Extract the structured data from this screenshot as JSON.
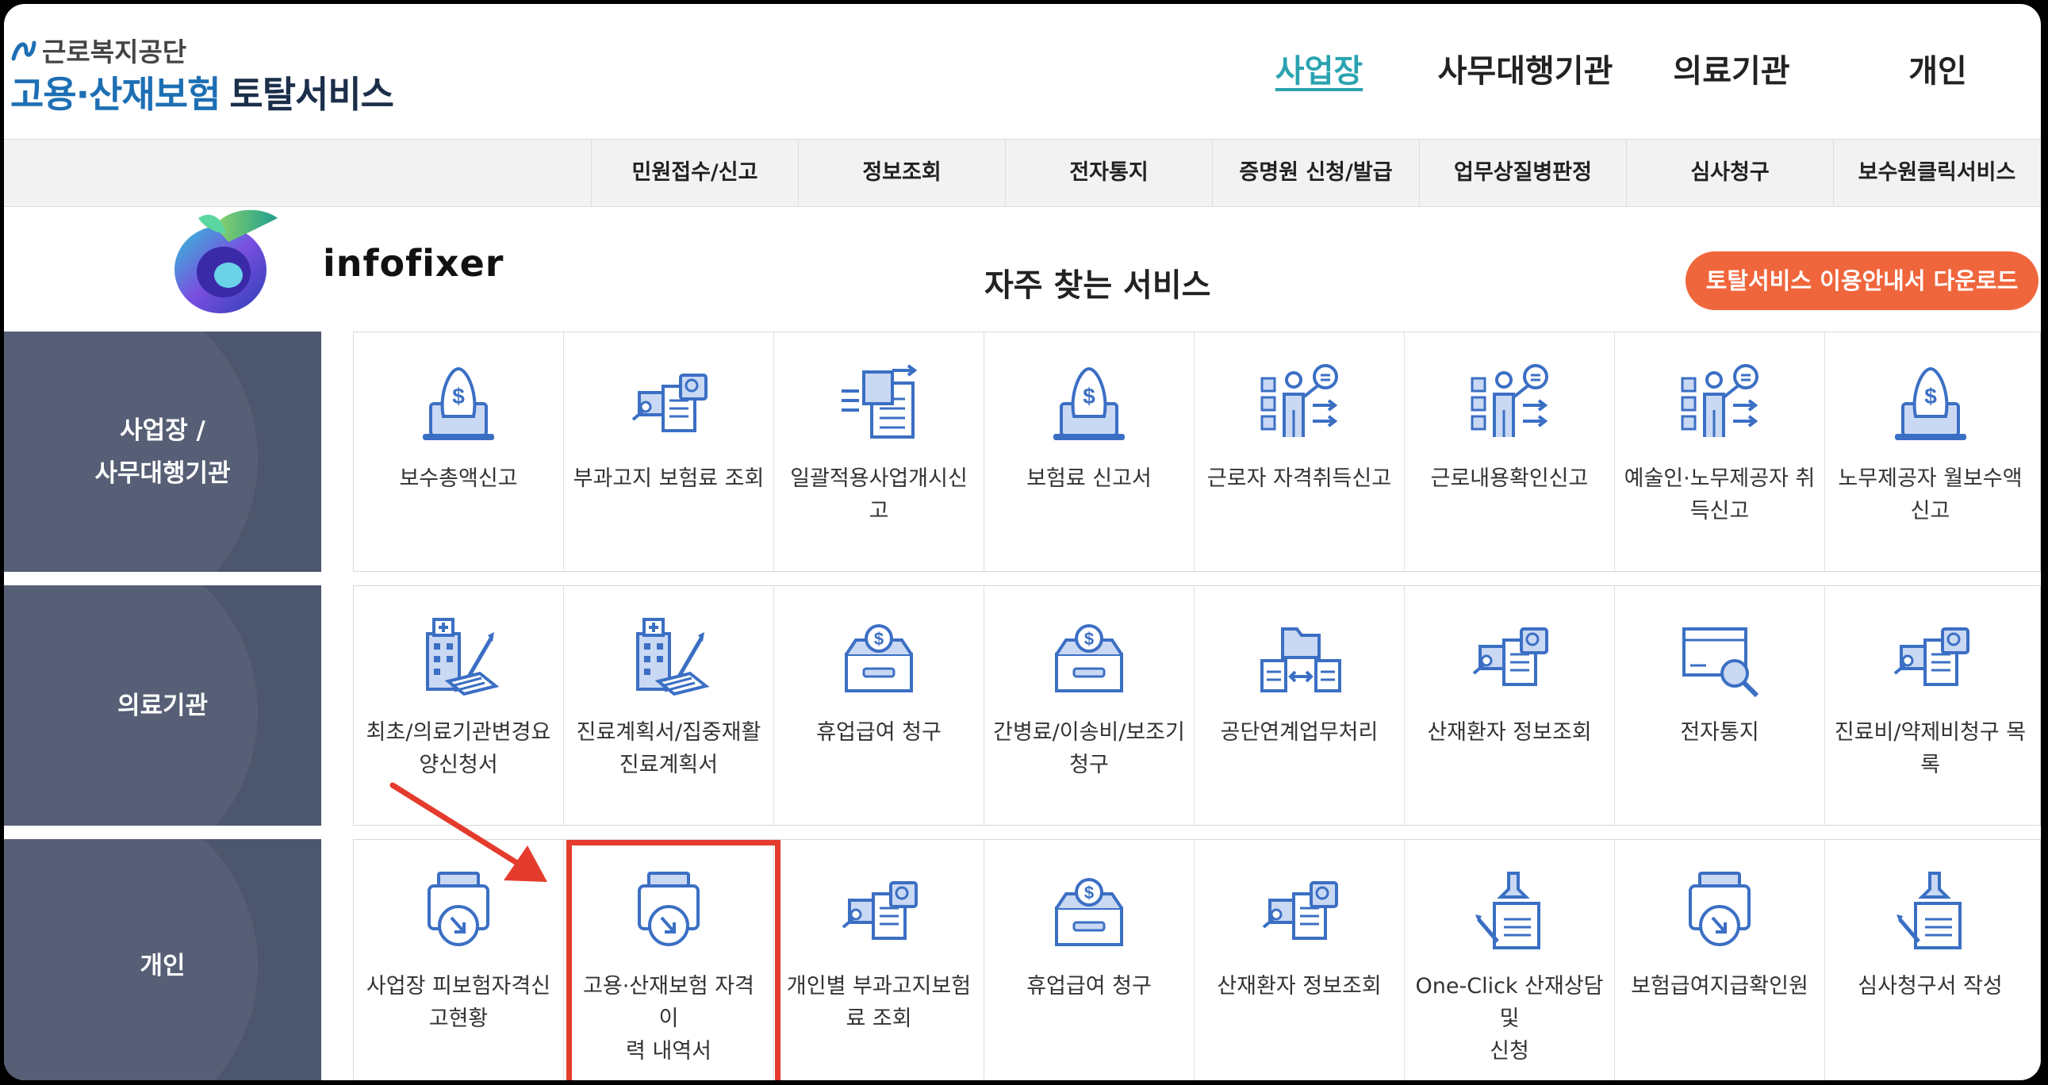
{
  "header": {
    "org_name": "근로복지공단",
    "service_title_main": "고용·산재보험",
    "service_title_sub": "토탈서비스"
  },
  "top_nav": [
    {
      "label": "사업장",
      "active": true
    },
    {
      "label": "사무대행기관",
      "active": false
    },
    {
      "label": "의료기관",
      "active": false
    },
    {
      "label": "개인",
      "active": false
    }
  ],
  "sub_nav": [
    "민원접수/신고",
    "정보조회",
    "전자통지",
    "증명원 신청/발급",
    "업무상질병판정",
    "심사청구",
    "보수원클릭서비스"
  ],
  "watermark": {
    "text": "infofixer"
  },
  "main": {
    "section_title": "자주 찾는 서비스",
    "guide_button": "토탈서비스 이용안내서 다운로드"
  },
  "categories": [
    {
      "label": "사업장 /\n사무대행기관",
      "services": [
        {
          "label": "보수총액신고",
          "icon": "money-laptop-icon"
        },
        {
          "label": "부과고지 보험료 조회",
          "icon": "document-search-icon"
        },
        {
          "label": "일괄적용사업개시신고",
          "icon": "document-transfer-icon"
        },
        {
          "label": "보험료 신고서",
          "icon": "money-laptop-icon"
        },
        {
          "label": "근로자 자격취득신고",
          "icon": "presenter-board-icon"
        },
        {
          "label": "근로내용확인신고",
          "icon": "presenter-board-icon"
        },
        {
          "label": "예술인·노무제공자 취\n득신고",
          "icon": "presenter-board-icon"
        },
        {
          "label": "노무제공자 월보수액\n신고",
          "icon": "money-laptop-icon"
        }
      ]
    },
    {
      "label": "의료기관",
      "services": [
        {
          "label": "최초/의료기관변경요\n양신청서",
          "icon": "hospital-document-icon"
        },
        {
          "label": "진료계획서/집중재활\n진료계획서",
          "icon": "hospital-document-icon"
        },
        {
          "label": "휴업급여 청구",
          "icon": "coin-box-icon"
        },
        {
          "label": "간병료/이송비/보조기\n청구",
          "icon": "coin-box-icon"
        },
        {
          "label": "공단연계업무처리",
          "icon": "folder-exchange-icon"
        },
        {
          "label": "산재환자 정보조회",
          "icon": "document-search-icon"
        },
        {
          "label": "전자통지",
          "icon": "box-magnifier-icon"
        },
        {
          "label": "진료비/약제비청구 목\n록",
          "icon": "document-search-icon"
        }
      ]
    },
    {
      "label": "개인",
      "services": [
        {
          "label": "사업장 피보험자격신\n고현황",
          "icon": "download-tray-icon"
        },
        {
          "label": "고용·산재보험 자격 이\n력 내역서",
          "icon": "download-tray-icon"
        },
        {
          "label": "개인별 부과고지보험\n료 조회",
          "icon": "document-search-icon"
        },
        {
          "label": "휴업급여 청구",
          "icon": "coin-box-icon"
        },
        {
          "label": "산재환자 정보조회",
          "icon": "document-search-icon"
        },
        {
          "label": "One-Click 산재상담 및\n신청",
          "icon": "stamp-document-icon"
        },
        {
          "label": "보험급여지급확인원",
          "icon": "download-tray-icon"
        },
        {
          "label": "심사청구서 작성",
          "icon": "stamp-document-icon"
        }
      ]
    }
  ],
  "colors": {
    "accent": "#2aa3b0",
    "brand_blue": "#1d6fb4",
    "side_panel": "#4c566d",
    "orange_button": "#f0663c",
    "icon_blue": "#3b6fc4",
    "highlight_red": "#e43b2c"
  }
}
